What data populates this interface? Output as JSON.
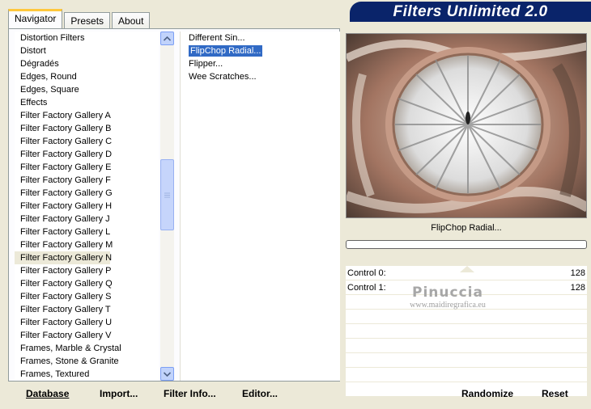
{
  "tabs": [
    "Navigator",
    "Presets",
    "About"
  ],
  "banner": {
    "title": "Filters Unlimited 2.0"
  },
  "categories": [
    "Distortion Filters",
    "Distort",
    "Dégradés",
    "Edges, Round",
    "Edges, Square",
    "Effects",
    "Filter Factory Gallery A",
    "Filter Factory Gallery B",
    "Filter Factory Gallery C",
    "Filter Factory Gallery D",
    "Filter Factory Gallery E",
    "Filter Factory Gallery F",
    "Filter Factory Gallery G",
    "Filter Factory Gallery H",
    "Filter Factory Gallery J",
    "Filter Factory Gallery L",
    "Filter Factory Gallery M",
    "Filter Factory Gallery N",
    "Filter Factory Gallery P",
    "Filter Factory Gallery Q",
    "Filter Factory Gallery S",
    "Filter Factory Gallery T",
    "Filter Factory Gallery U",
    "Filter Factory Gallery V",
    "Frames, Marble & Crystal",
    "Frames, Stone & Granite",
    "Frames, Textured"
  ],
  "selected_category": "Filter Factory Gallery N",
  "filters": [
    "Different Sin...",
    "FlipChop Radial...",
    "Flipper...",
    "Wee Scratches..."
  ],
  "selected_filter": "FlipChop Radial...",
  "preview": {
    "filter_name": "FlipChop Radial..."
  },
  "controls": [
    {
      "label": "Control 0:",
      "value": "128"
    },
    {
      "label": "Control 1:",
      "value": "128"
    }
  ],
  "watermark": {
    "name": "Pinuccia",
    "site": "www.maidiregrafica.eu"
  },
  "buttons": {
    "database": "Database",
    "import": "Import...",
    "filter_info": "Filter Info...",
    "editor": "Editor...",
    "randomize": "Randomize",
    "reset": "Reset"
  }
}
